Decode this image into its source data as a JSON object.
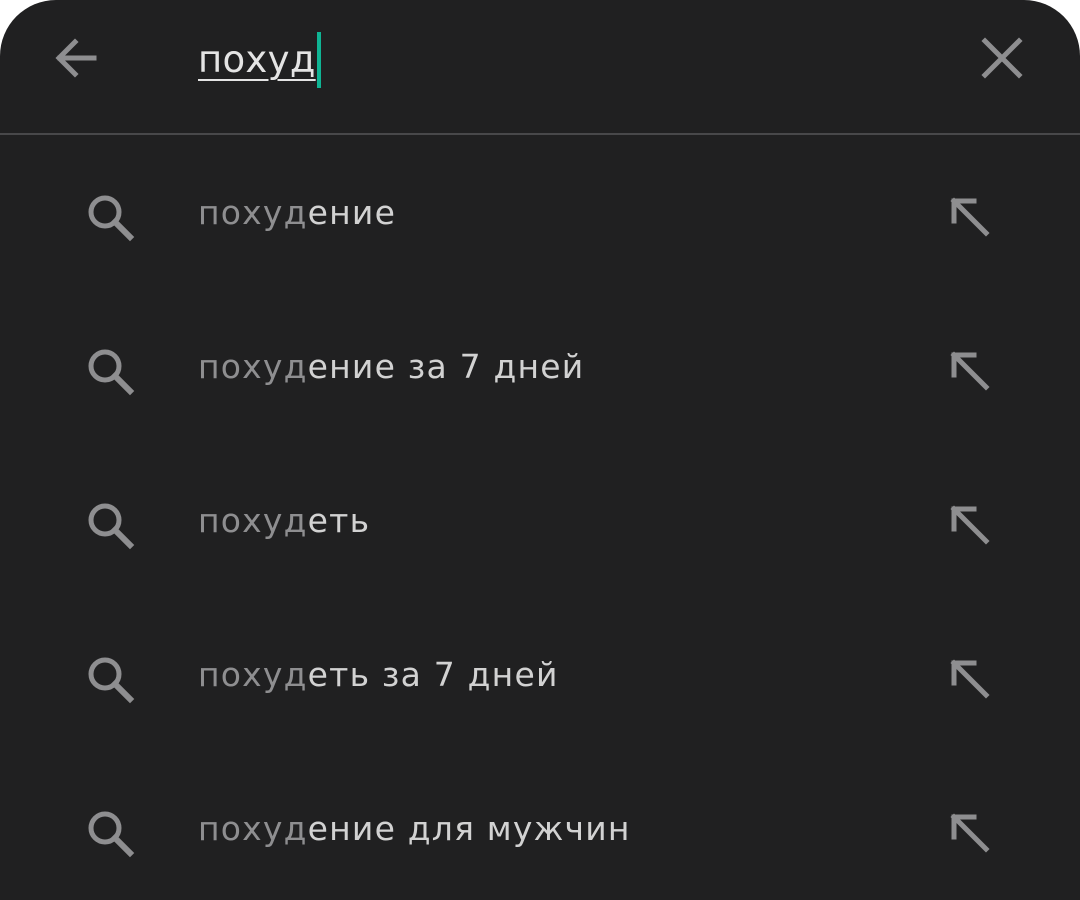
{
  "search": {
    "query": "похуд",
    "back_icon": "arrow-left-icon",
    "clear_icon": "close-icon",
    "caret_color": "#0fb494"
  },
  "theme": {
    "background": "#202021",
    "text": "#d2d2d2",
    "muted_text": "#8e8e90",
    "icon": "#8e8e90"
  },
  "suggestions": [
    {
      "prefix": "похуд",
      "rest": "ение",
      "icon": "search-icon",
      "action_icon": "arrow-up-left-icon"
    },
    {
      "prefix": "похуд",
      "rest": "ение за 7 дней",
      "icon": "search-icon",
      "action_icon": "arrow-up-left-icon"
    },
    {
      "prefix": "похуд",
      "rest": "еть",
      "icon": "search-icon",
      "action_icon": "arrow-up-left-icon"
    },
    {
      "prefix": "похуд",
      "rest": "еть за 7 дней",
      "icon": "search-icon",
      "action_icon": "arrow-up-left-icon"
    },
    {
      "prefix": "похуд",
      "rest": "ение для мужчин",
      "icon": "search-icon",
      "action_icon": "arrow-up-left-icon"
    }
  ]
}
